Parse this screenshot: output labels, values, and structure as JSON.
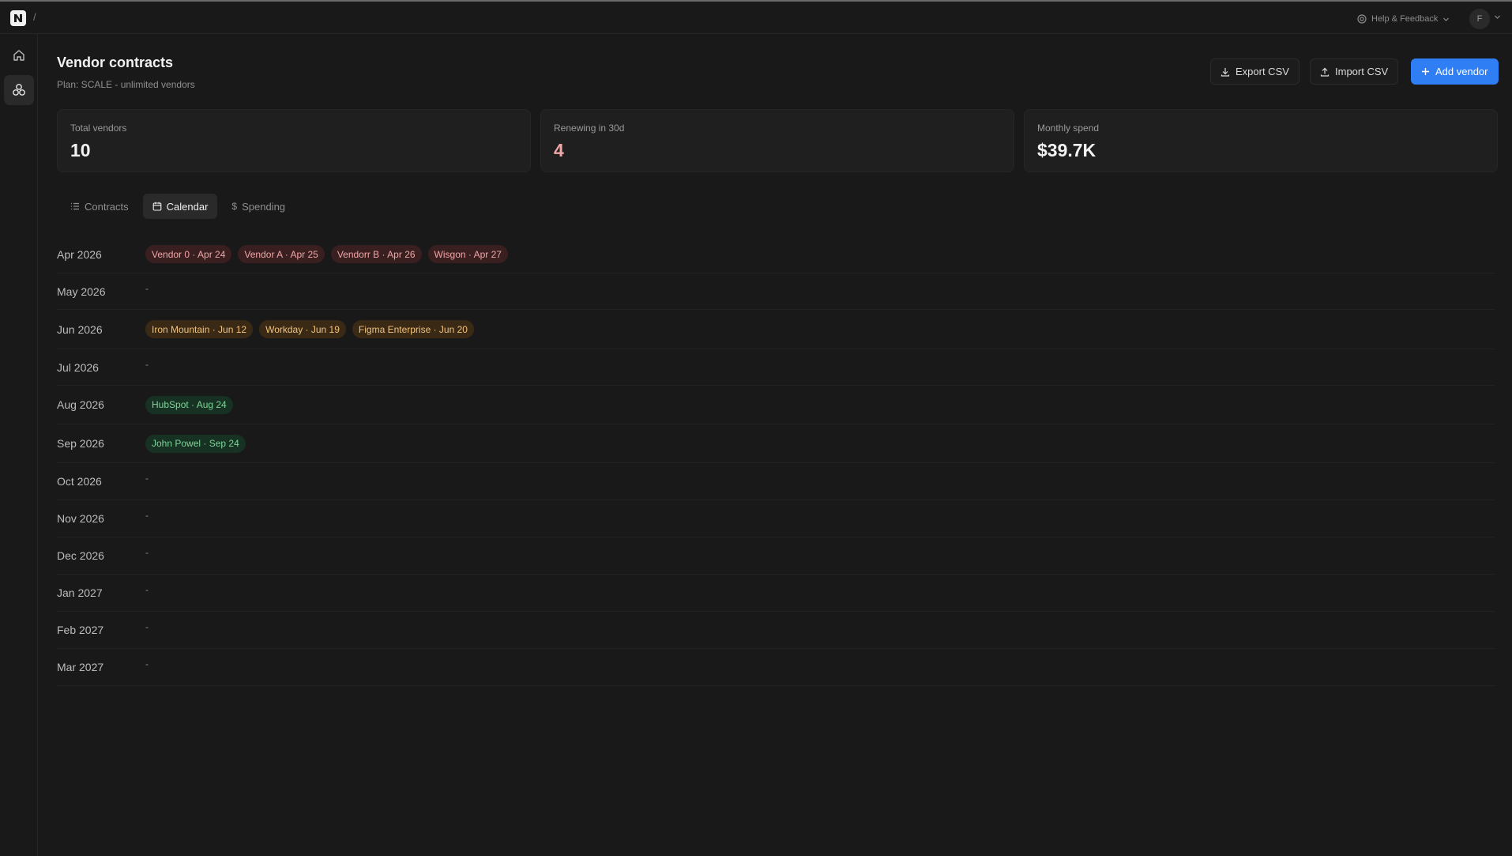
{
  "app": {
    "breadcrumb_sep": "/",
    "help_label": "Help & Feedback",
    "user_initial": "F"
  },
  "colors": {
    "accent": "#2f7ef4",
    "urgent": "#f0a6a6",
    "soon": "#f1c27d",
    "later": "#7ed39a"
  },
  "icons": {
    "home": "home-icon",
    "vendors": "vendors-icon",
    "help": "help-icon",
    "export": "download-icon",
    "import": "upload-icon",
    "add": "plus-icon",
    "contracts": "list-icon",
    "calendar": "calendar-icon",
    "spending": "dollar-icon"
  },
  "header": {
    "title": "Vendor contracts",
    "subtitle": "Plan: SCALE - unlimited vendors",
    "export_label": "Export CSV",
    "import_label": "Import CSV",
    "add_label": "Add vendor"
  },
  "stats": [
    {
      "label": "Total vendors",
      "value": "10",
      "color": "#f2f2f2"
    },
    {
      "label": "Renewing in 30d",
      "value": "4",
      "color": "#f0a6a6"
    },
    {
      "label": "Monthly spend",
      "value": "$39.7K",
      "color": "#f2f2f2"
    }
  ],
  "tabs": [
    {
      "label": "Contracts",
      "active": false
    },
    {
      "label": "Calendar",
      "active": true
    },
    {
      "label": "Spending",
      "active": false
    }
  ],
  "calendar": {
    "empty_marker": "-",
    "months": [
      {
        "month": "Apr 2026",
        "chips": [
          {
            "text": "Vendor 0 · Apr 24",
            "tone": "red"
          },
          {
            "text": "Vendor A · Apr 25",
            "tone": "red"
          },
          {
            "text": "Vendorr B · Apr 26",
            "tone": "red"
          },
          {
            "text": "Wisgon · Apr 27",
            "tone": "red"
          }
        ]
      },
      {
        "month": "May 2026",
        "chips": []
      },
      {
        "month": "Jun 2026",
        "chips": [
          {
            "text": "Iron Mountain · Jun 12",
            "tone": "amber"
          },
          {
            "text": "Workday · Jun 19",
            "tone": "amber"
          },
          {
            "text": "Figma Enterprise · Jun 20",
            "tone": "amber"
          }
        ]
      },
      {
        "month": "Jul 2026",
        "chips": []
      },
      {
        "month": "Aug 2026",
        "chips": [
          {
            "text": "HubSpot · Aug 24",
            "tone": "green"
          }
        ]
      },
      {
        "month": "Sep 2026",
        "chips": [
          {
            "text": "John Powel · Sep 24",
            "tone": "green"
          }
        ]
      },
      {
        "month": "Oct 2026",
        "chips": []
      },
      {
        "month": "Nov 2026",
        "chips": []
      },
      {
        "month": "Dec 2026",
        "chips": []
      },
      {
        "month": "Jan 2027",
        "chips": []
      },
      {
        "month": "Feb 2027",
        "chips": []
      },
      {
        "month": "Mar 2027",
        "chips": []
      }
    ]
  }
}
